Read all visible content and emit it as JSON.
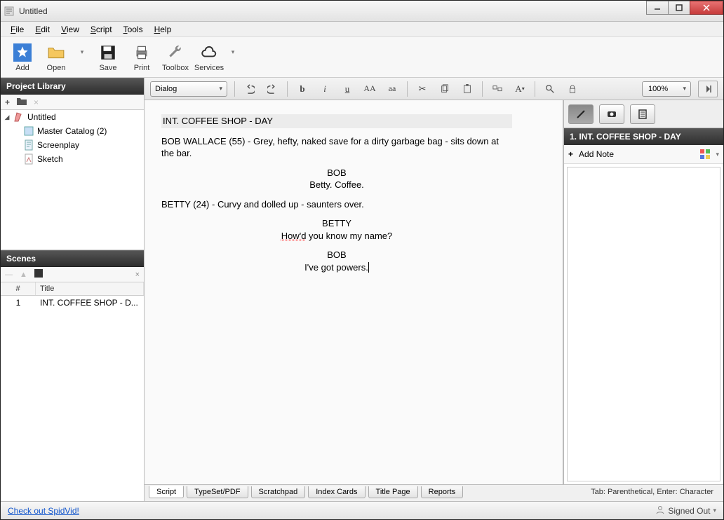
{
  "window": {
    "title": "Untitled"
  },
  "menu": {
    "file": "File",
    "edit": "Edit",
    "view": "View",
    "script": "Script",
    "tools": "Tools",
    "help": "Help"
  },
  "toolbar": {
    "add": "Add",
    "open": "Open",
    "save": "Save",
    "print": "Print",
    "toolbox": "Toolbox",
    "services": "Services"
  },
  "left": {
    "library_title": "Project Library",
    "tree": {
      "root": "Untitled",
      "items": [
        {
          "label": "Master Catalog (2)"
        },
        {
          "label": "Screenplay"
        },
        {
          "label": "Sketch"
        }
      ]
    },
    "scenes_title": "Scenes",
    "scene_head_num": "#",
    "scene_head_title": "Title",
    "scenes": [
      {
        "num": "1",
        "title": "INT. COFFEE SHOP - D..."
      }
    ],
    "promo": "Check out SpidVid!"
  },
  "editor": {
    "element_dropdown": "Dialog",
    "zoom": "100%",
    "script": {
      "slugline": "INT. COFFEE SHOP - DAY",
      "action1": "BOB WALLACE (55) - Grey, hefty, naked save for a dirty garbage bag - sits down at the bar.",
      "char1": "BOB",
      "dialog1": "Betty.  Coffee.",
      "action2": "BETTY (24) - Curvy and dolled up - saunters over.",
      "char2": "BETTY",
      "dialog2_pre": "How'd",
      "dialog2_post": " you know my name?",
      "char3": "BOB",
      "dialog3": "I've got powers."
    },
    "bottom_tabs": {
      "script": "Script",
      "typeset": "TypeSet/PDF",
      "scratchpad": "Scratchpad",
      "index": "Index Cards",
      "titlepage": "Title Page",
      "reports": "Reports"
    },
    "hint": "Tab: Parenthetical, Enter: Character"
  },
  "right": {
    "scene_label": "1. INT. COFFEE SHOP - DAY",
    "add_note": "Add Note"
  },
  "status": {
    "signed": "Signed Out"
  }
}
